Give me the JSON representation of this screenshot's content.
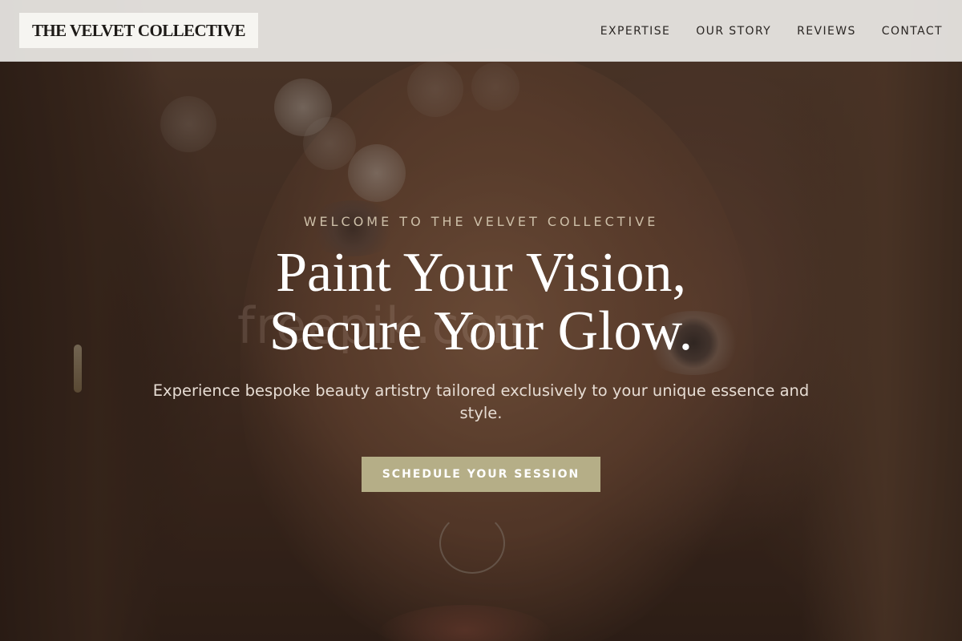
{
  "header": {
    "logo_text": "THE VELVET COLLECTIVE",
    "nav": [
      {
        "label": "EXPERTISE"
      },
      {
        "label": "OUR STORY"
      },
      {
        "label": "REVIEWS"
      },
      {
        "label": "CONTACT"
      }
    ]
  },
  "hero": {
    "eyebrow": "WELCOME TO THE VELVET COLLECTIVE",
    "headline_line1": "Paint Your Vision,",
    "headline_line2": "Secure Your Glow.",
    "subtext": "Experience bespoke beauty artistry tailored exclusively to your unique essence and style.",
    "cta_label": "SCHEDULE YOUR SESSION",
    "background_text": "freepik.com"
  },
  "colors": {
    "header_bg": "#e8e5e2",
    "logo_bg": "#f6f5f1",
    "accent": "#b5ae87",
    "eyebrow": "#cdbfa8",
    "headline": "#ffffff"
  }
}
